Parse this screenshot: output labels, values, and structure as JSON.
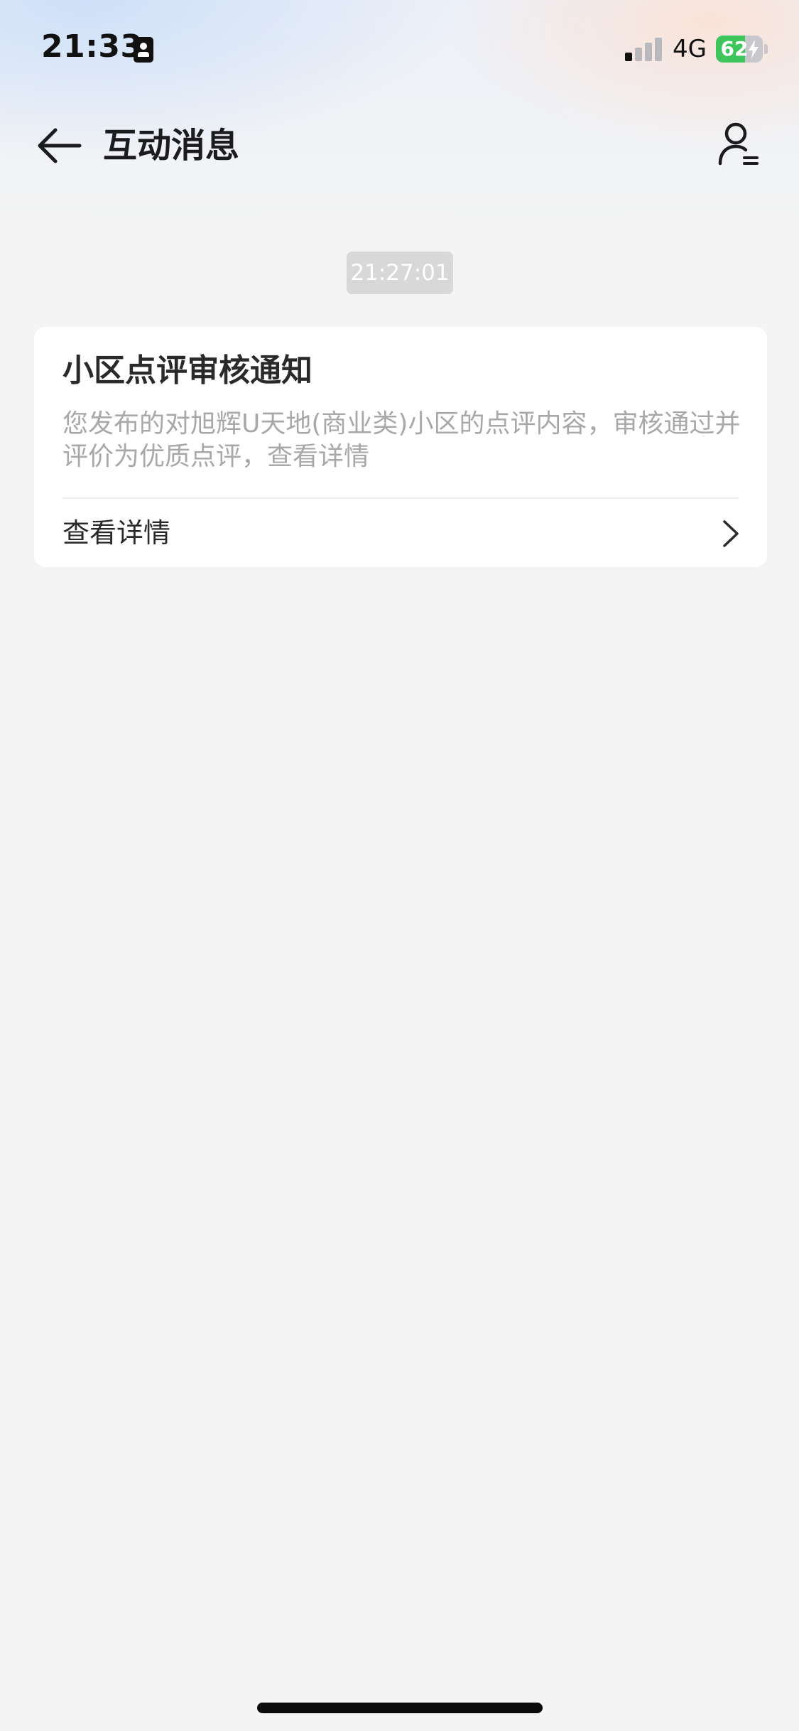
{
  "status_bar": {
    "time": "21:33",
    "network": "4G",
    "battery": "62",
    "battery_level": 0.62,
    "signal_bars_active": 1,
    "signal_bars_total": 4
  },
  "nav": {
    "title": "互动消息",
    "back_icon": "back-arrow-icon",
    "profile_icon": "user-settings-icon"
  },
  "message": {
    "timestamp": "21:27:01",
    "title": "小区点评审核通知",
    "body": "您发布的对旭辉U天地(商业类)小区的点评内容，审核通过并评价为优质点评，查看详情",
    "action_label": "查看详情"
  },
  "colors": {
    "background": "#f4f4f4",
    "card": "#ffffff",
    "title_text": "#2a2a2c",
    "secondary_text": "#a8a8aa",
    "battery_green": "#3ec65c"
  }
}
